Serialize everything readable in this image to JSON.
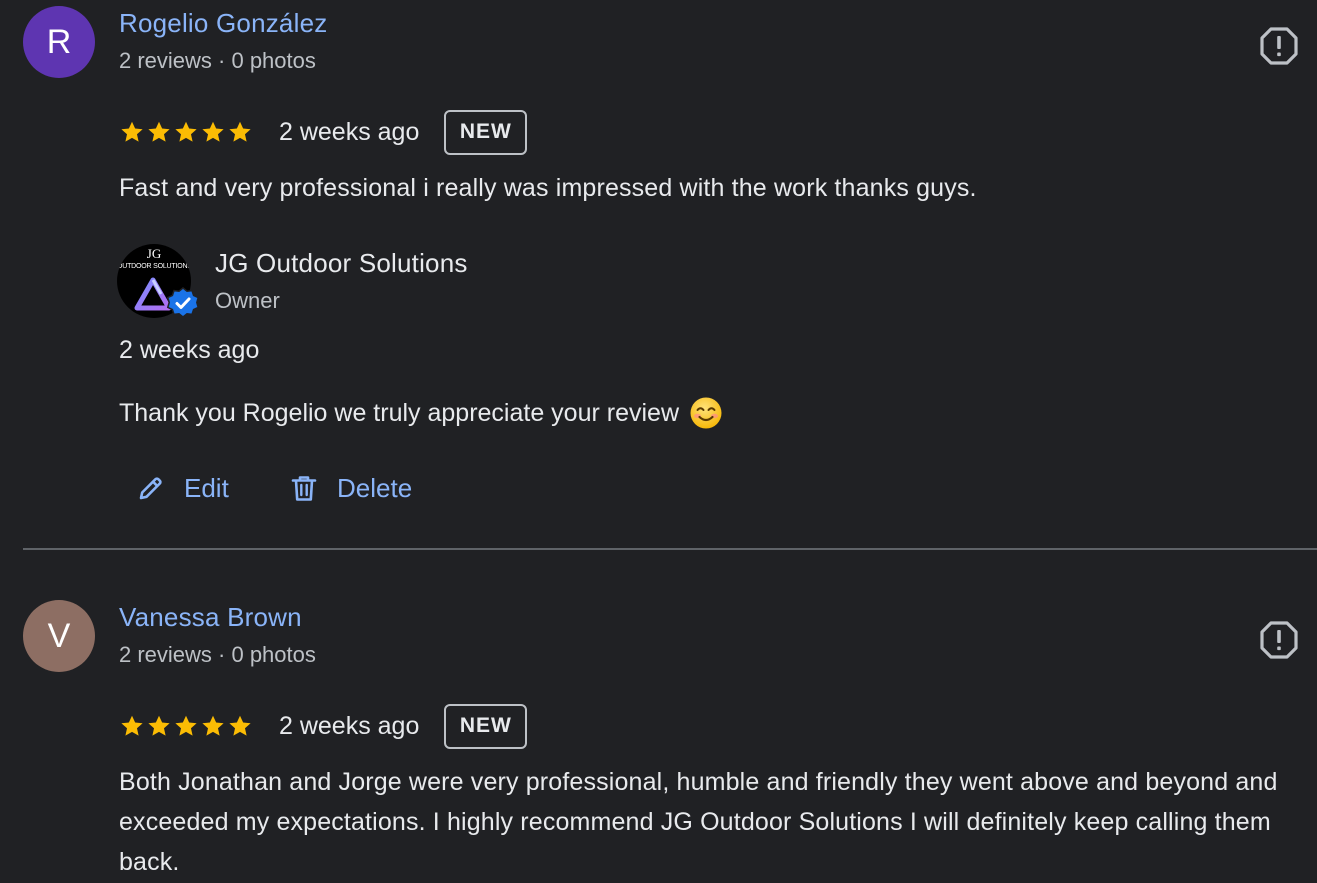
{
  "reviews": [
    {
      "avatar_letter": "R",
      "avatar_color": "#5e35b1",
      "name": "Rogelio González",
      "meta": "2 reviews · 0 photos",
      "rating": 5,
      "date": "2 weeks ago",
      "badge": "NEW",
      "text": "Fast and very professional i really was impressed with the work thanks guys.",
      "owner_reply": {
        "logo_line1": "JG",
        "logo_line2": "OUTDOOR SOLUTIONS",
        "name": "JG Outdoor Solutions",
        "role": "Owner",
        "date": "2 weeks ago",
        "text": "Thank you Rogelio we truly appreciate your review",
        "emoji": "smiling-face-icon"
      },
      "actions": {
        "edit_label": "Edit",
        "delete_label": "Delete"
      }
    },
    {
      "avatar_letter": "V",
      "avatar_color": "#8d6e63",
      "name": "Vanessa Brown",
      "meta": "2 reviews · 0 photos",
      "rating": 5,
      "date": "2 weeks ago",
      "badge": "NEW",
      "text": "Both Jonathan and Jorge were very professional, humble and friendly they went above and beyond and exceeded my expectations. I highly recommend JG Outdoor Solutions I will definitely keep calling them back."
    }
  ],
  "icons": {
    "flag": "report-flag-icon",
    "star": "star-icon",
    "edit": "pencil-icon",
    "delete": "trash-icon",
    "verified": "verified-check-icon"
  },
  "colors": {
    "link": "#8ab4f8",
    "star": "#fbbc04",
    "background": "#202124",
    "verified": "#1a73e8"
  }
}
